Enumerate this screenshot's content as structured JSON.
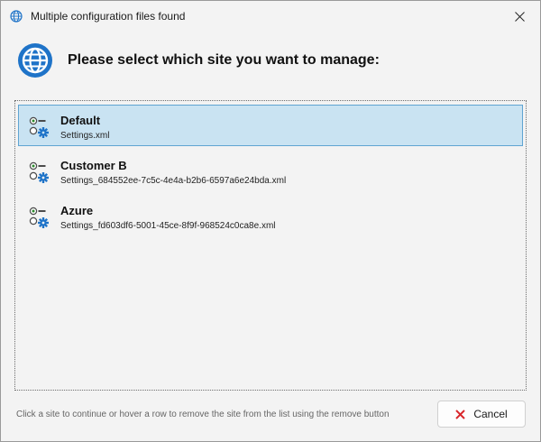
{
  "window": {
    "title": "Multiple configuration files found",
    "title_icon": "globe-icon",
    "close_icon": "close-icon"
  },
  "header": {
    "icon": "globe-icon",
    "text": "Please select which site you want to manage:"
  },
  "sites": [
    {
      "name": "Default",
      "file": "Settings.xml",
      "selected": true,
      "icon": "site-settings-icon"
    },
    {
      "name": "Customer B",
      "file": "Settings_684552ee-7c5c-4e4a-b2b6-6597a6e24bda.xml",
      "selected": false,
      "icon": "site-settings-icon"
    },
    {
      "name": "Azure",
      "file": "Settings_fd603df6-5001-45ce-8f9f-968524c0ca8e.xml",
      "selected": false,
      "icon": "site-settings-icon"
    }
  ],
  "footer": {
    "hint": "Click a site to continue or hover a row to remove the site from the list using the remove button",
    "cancel_label": "Cancel",
    "cancel_icon": "red-x-icon"
  },
  "colors": {
    "accent": "#1e73c8",
    "selection": "#c9e3f2",
    "cancel_red": "#d9262b"
  }
}
